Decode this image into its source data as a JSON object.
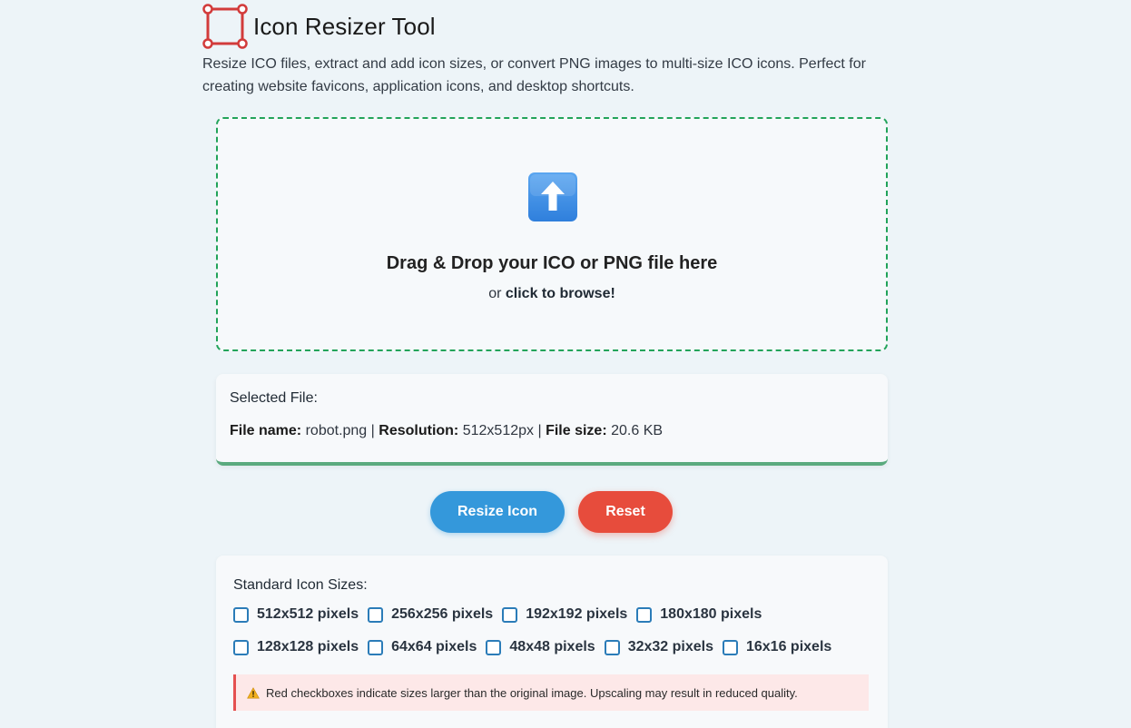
{
  "header": {
    "title": "Icon Resizer Tool",
    "logo_icon": "resize-square-icon"
  },
  "description": "Resize ICO files, extract and add icon sizes, or convert PNG images to multi-size ICO icons. Perfect for creating website favicons, application icons, and desktop shortcuts.",
  "dropzone": {
    "icon": "up-arrow-icon",
    "title": "Drag & Drop your ICO or PNG file here",
    "sub_prefix": "or",
    "sub_link": "click to browse!"
  },
  "file_info": {
    "label": "Selected File:",
    "name_label": "File name:",
    "name_value": "robot.png",
    "resolution_label": "Resolution:",
    "resolution_value": "512x512px",
    "size_label": "File size:",
    "size_value": "20.6 KB",
    "separator": "|"
  },
  "buttons": {
    "resize": "Resize Icon",
    "reset": "Reset"
  },
  "sizes": {
    "label": "Standard Icon Sizes:",
    "row1": [
      "512x512 pixels",
      "256x256 pixels",
      "192x192 pixels",
      "180x180 pixels"
    ],
    "row2": [
      "128x128 pixels",
      "64x64 pixels",
      "48x48 pixels",
      "32x32 pixels",
      "16x16 pixels"
    ]
  },
  "warning": {
    "icon": "warning-icon",
    "text": "Red checkboxes indicate sizes larger than the original image. Upscaling may result in reduced quality."
  },
  "colors": {
    "accent_blue": "#3498db",
    "reset_red": "#e74c3c",
    "dropzone_border": "#22a35a",
    "file_card_border": "#5aaa7e",
    "logo_red": "#d23b3b"
  }
}
